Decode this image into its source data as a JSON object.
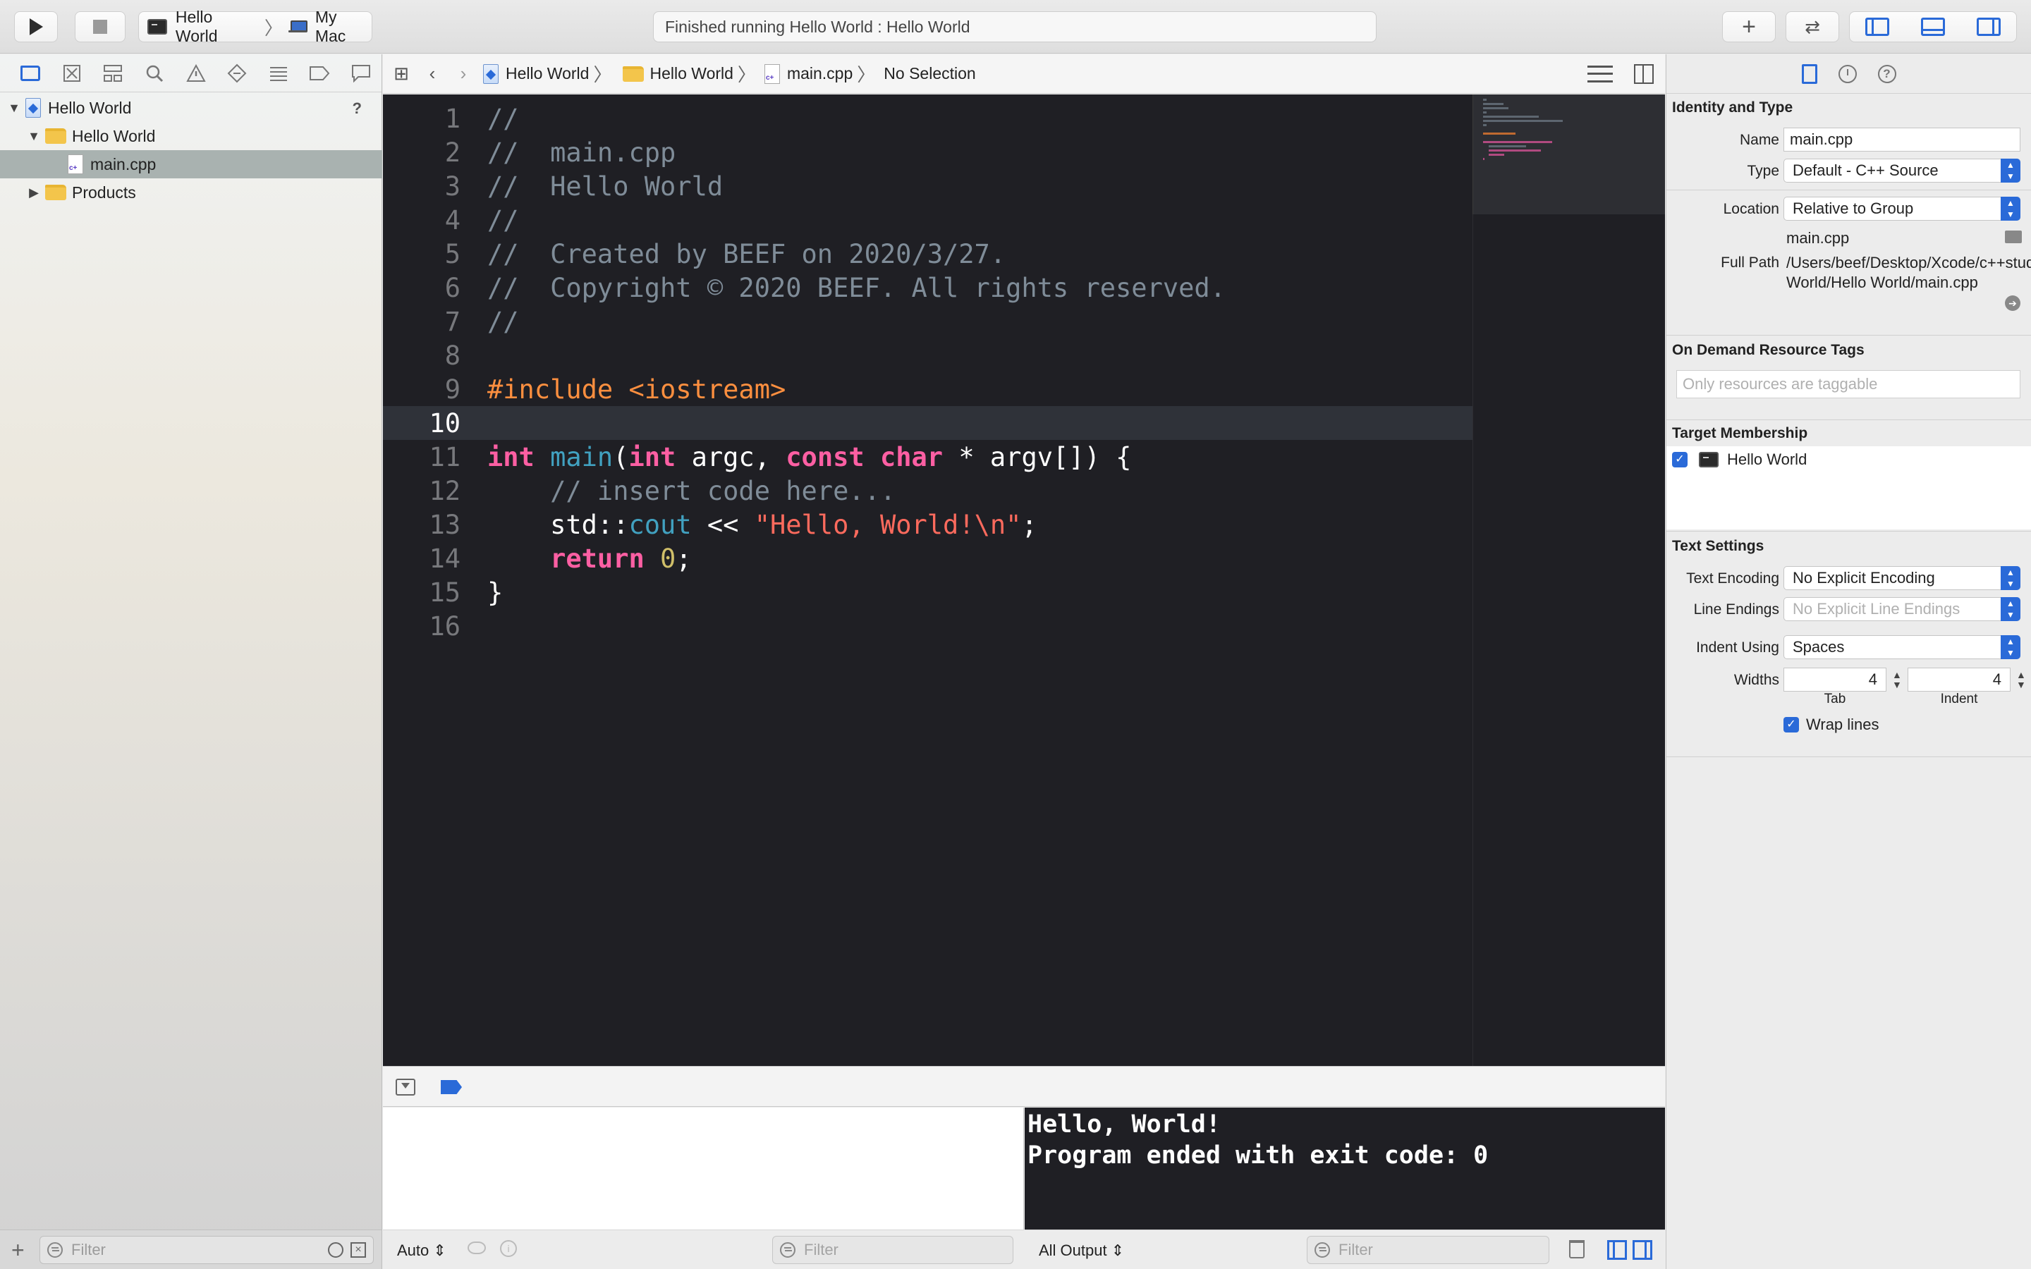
{
  "toolbar": {
    "scheme_target": "Hello World",
    "scheme_device": "My Mac",
    "activity": "Finished running Hello World : Hello World"
  },
  "navigator": {
    "tree": [
      {
        "label": "Hello World",
        "type": "project"
      },
      {
        "label": "Hello World",
        "type": "folder"
      },
      {
        "label": "main.cpp",
        "type": "file"
      },
      {
        "label": "Products",
        "type": "folder"
      }
    ],
    "help_mark": "?",
    "filter_placeholder": "Filter"
  },
  "jumpbar": {
    "crumbs": [
      "Hello World",
      "Hello World",
      "main.cpp",
      "No Selection"
    ]
  },
  "editor": {
    "current_line": 10,
    "line_numbers": [
      "1",
      "2",
      "3",
      "4",
      "5",
      "6",
      "7",
      "8",
      "9",
      "10",
      "11",
      "12",
      "13",
      "14",
      "15",
      "16"
    ],
    "lines": [
      "//",
      "//  main.cpp",
      "//  Hello World",
      "//",
      "//  Created by BEEF on 2020/3/27.",
      "//  Copyright © 2020 BEEF. All rights reserved.",
      "//",
      "",
      "#include <iostream>",
      "",
      "int main(int argc, const char * argv[]) {",
      "    // insert code here...",
      "    std::cout << \"Hello, World!\\n\";",
      "    return 0;",
      "}",
      ""
    ]
  },
  "debug": {
    "variables_scope": "Auto ⇕",
    "filter_placeholder": "Filter",
    "console_output": "Hello, World!\nProgram ended with exit code: 0",
    "output_scope": "All Output ⇕"
  },
  "inspector": {
    "identity_title": "Identity and Type",
    "name_label": "Name",
    "name_value": "main.cpp",
    "type_label": "Type",
    "type_value": "Default - C++ Source",
    "location_label": "Location",
    "location_value": "Relative to Group",
    "location_file": "main.cpp",
    "fullpath_label": "Full Path",
    "fullpath_value": "/Users/beef/Desktop/Xcode/c++study/Hello World/Hello World/main.cpp",
    "tags_title": "On Demand Resource Tags",
    "tags_placeholder": "Only resources are taggable",
    "membership_title": "Target Membership",
    "membership_target": "Hello World",
    "text_settings_title": "Text Settings",
    "encoding_label": "Text Encoding",
    "encoding_value": "No Explicit Encoding",
    "line_endings_label": "Line Endings",
    "line_endings_value": "No Explicit Line Endings",
    "indent_label": "Indent Using",
    "indent_value": "Spaces",
    "widths_label": "Widths",
    "tab_width": "4",
    "indent_width": "4",
    "tab_label": "Tab",
    "indent_sub_label": "Indent",
    "wrap_label": "Wrap lines"
  },
  "colors": {
    "accent": "#2a6ad8",
    "editor_bg": "#1f1f24",
    "keyword": "#fc5fa3",
    "string": "#fc6a5d",
    "comment": "#7f8c98",
    "preprocessor": "#fd8f3f"
  }
}
